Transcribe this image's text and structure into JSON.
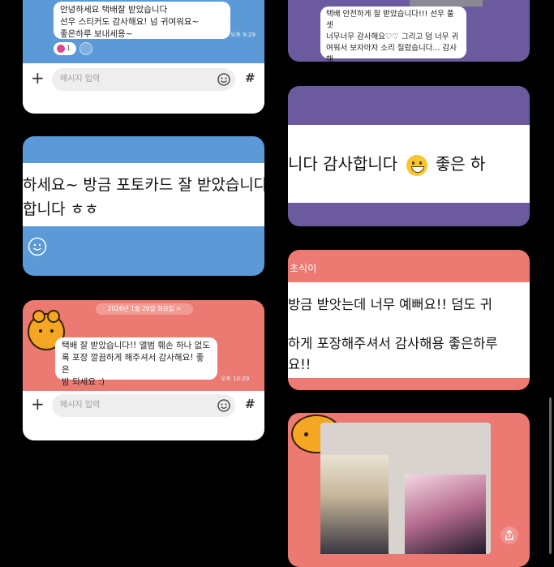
{
  "cards": {
    "card1": {
      "bubble": "안녕하세요 택배잘 받았습니다\n선우 스티커도 감사해요! 넘 귀여워요~\n좋은하루 보내세용~",
      "time": "오후 9:29",
      "reaction_count": "1",
      "input_placeholder": "메시지 입력"
    },
    "card2": {
      "line1": "하세요~ 방금 포토카드 잘 받았습니다",
      "line2": "합니다 ㅎㅎ"
    },
    "card3": {
      "date": "2026년 1월 20일 화요일 >",
      "bubble": "택배 잘 받았습니다!! 앨범 훼손 하나 없도\n록 포장 깔끔하게 해주셔서 감사해요! 좋은\n밤 되세요 :)",
      "time": "오후 10:29",
      "input_placeholder": "메시지 입력"
    },
    "card4": {
      "bubble": "택배 안전하게 잘 받았습니다!!! 선우 풀셋\n너무너무 감사해요♡♡ 그리고 덤 너무 귀\n여워서 보자마자 소리 질렀습니다... 감사해\n요!!!"
    },
    "card5": {
      "text": "니다 감사합니다",
      "text2": "좋은 하"
    },
    "card6": {
      "name": "초식이",
      "line1": "방금 받앗는데 너무 예뻐요!! 덤도 귀",
      "line2": "하게 포장해주셔서 감사해용 좋은하루",
      "line3": "요!!"
    }
  },
  "colors": {
    "blue": "#5b9ad6",
    "purple": "#6b5b9e",
    "coral": "#ec7a72"
  }
}
